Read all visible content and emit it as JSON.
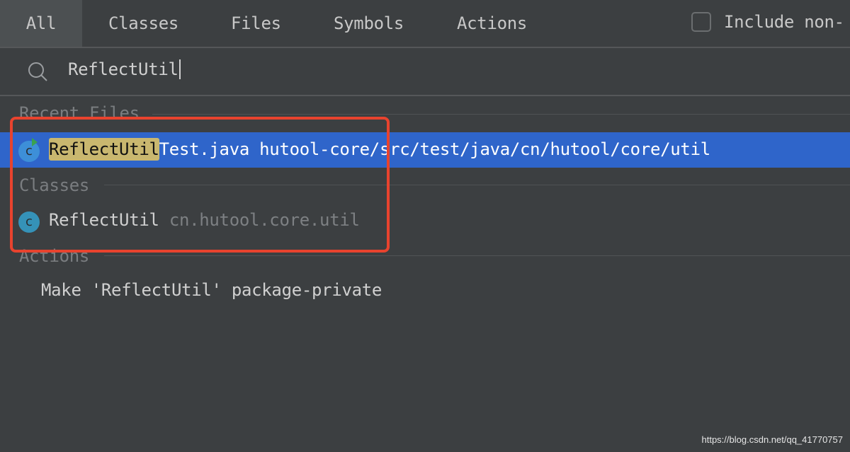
{
  "tabs": [
    {
      "label": "All",
      "selected": true
    },
    {
      "label": "Classes"
    },
    {
      "label": "Files"
    },
    {
      "label": "Symbols"
    },
    {
      "label": "Actions"
    }
  ],
  "include_checkbox": {
    "label": "Include non-",
    "checked": false
  },
  "search": {
    "value": "ReflectUtil",
    "icon": "search-icon"
  },
  "sections": {
    "recent_files": {
      "title": "Recent Files",
      "items": [
        {
          "match": "ReflectUtil",
          "rest": "Test.java",
          "path": "hutool-core/src/test/java/cn/hutool/core/util",
          "icon": "java-class-icon"
        }
      ]
    },
    "classes": {
      "title": "Classes",
      "items": [
        {
          "name": "ReflectUtil",
          "package": "cn.hutool.core.util",
          "icon": "class-icon"
        }
      ]
    },
    "actions": {
      "title": "Actions",
      "items": [
        {
          "label": "Make 'ReflectUtil' package-private"
        }
      ]
    }
  },
  "colors": {
    "background": "#3c3f41",
    "selection": "#2f65ca",
    "match_highlight": "#c9b76f",
    "annotation": "#e8432e"
  },
  "watermark": "https://blog.csdn.net/qq_41770757"
}
